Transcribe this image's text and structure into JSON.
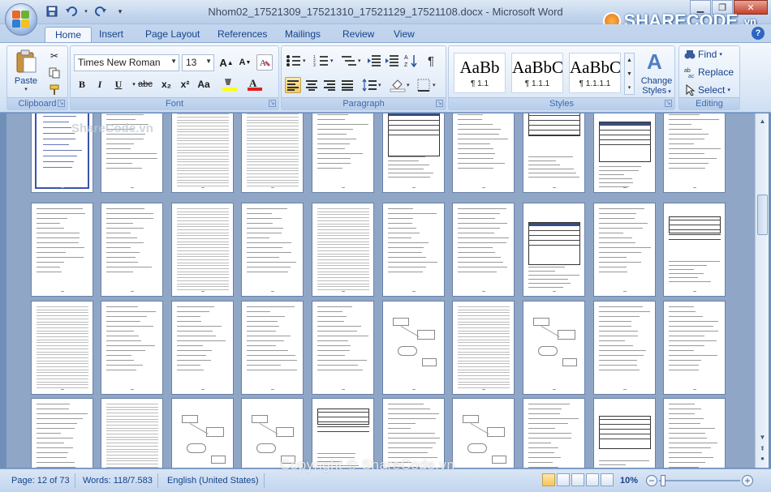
{
  "window": {
    "title": "Nhom02_17521309_17521310_17521129_17521108.docx - Microsoft Word",
    "controls": [
      "minimize",
      "restore",
      "close"
    ]
  },
  "watermark_logo": {
    "brand": "SHARECODE",
    "suffix": ".vn"
  },
  "quick_access": [
    "save-icon",
    "undo-icon",
    "redo-icon",
    "customize-icon"
  ],
  "tabs": [
    "Home",
    "Insert",
    "Page Layout",
    "References",
    "Mailings",
    "Review",
    "View"
  ],
  "active_tab": "Home",
  "ribbon": {
    "clipboard": {
      "label": "Clipboard",
      "paste": "Paste"
    },
    "font": {
      "label": "Font",
      "family": "Times New Roman",
      "size": "13",
      "buttons": [
        "B",
        "I",
        "U",
        "abc",
        "x₂",
        "x²",
        "Aa"
      ]
    },
    "paragraph": {
      "label": "Paragraph"
    },
    "styles": {
      "label": "Styles",
      "items": [
        {
          "preview": "AaBb",
          "name": "¶ 1.1"
        },
        {
          "preview": "AaBbC",
          "name": "¶ 1.1.1"
        },
        {
          "preview": "AaBbC",
          "name": "¶ 1.1.1.1"
        }
      ],
      "change_styles_line1": "Change",
      "change_styles_line2": "Styles"
    },
    "editing": {
      "label": "Editing",
      "find": "Find",
      "replace": "Replace",
      "select": "Select"
    }
  },
  "document": {
    "watermark_top": "ShareCode.vn",
    "pages_visible": 40
  },
  "status": {
    "page": "Page: 12 of 73",
    "words": "Words: 118/7.583",
    "language": "English (United States)",
    "zoom": "10%"
  },
  "footer_watermark": "Copyright © ShareCode.vn",
  "colors": {
    "accent": "#15428b",
    "ribbon_bg": "#dbe7f6",
    "doc_bg": "#8fa6c6"
  }
}
